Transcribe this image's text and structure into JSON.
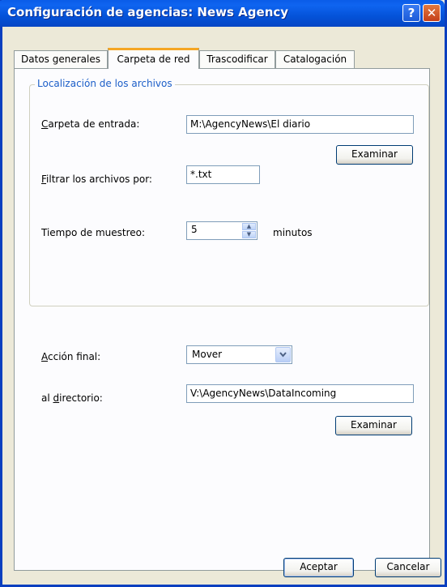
{
  "window": {
    "title": "Configuración de agencias: News Agency",
    "help_label": "?",
    "close_label": "✕"
  },
  "tabs": [
    {
      "label": "Datos generales"
    },
    {
      "label": "Carpeta de red"
    },
    {
      "label": "Trascodificar"
    },
    {
      "label": "Catalogación"
    }
  ],
  "active_tab": "Carpeta de red",
  "group": {
    "legend": "Localización de los archivos"
  },
  "form": {
    "input_folder": {
      "label_mnemonic": "C",
      "label_rest": "arpeta de entrada:",
      "value": "M:\\AgencyNews\\El diario",
      "browse_label": "Examinar"
    },
    "filter": {
      "label_mnemonic": "F",
      "label_rest": "iltrar los archivos por:",
      "value": "*.txt"
    },
    "sampling": {
      "label": "Tiempo de muestreo:",
      "value": "5",
      "unit": "minutos"
    },
    "final_action": {
      "label_mnemonic": "A",
      "label_rest": "cción final:",
      "value": "Mover"
    },
    "target_dir": {
      "label_pre": "al ",
      "label_mnemonic": "d",
      "label_rest": "irectorio:",
      "value": "V:\\AgencyNews\\DataIncoming",
      "browse_label": "Examinar"
    }
  },
  "footer": {
    "ok_label": "Aceptar",
    "cancel_label": "Cancelar"
  }
}
